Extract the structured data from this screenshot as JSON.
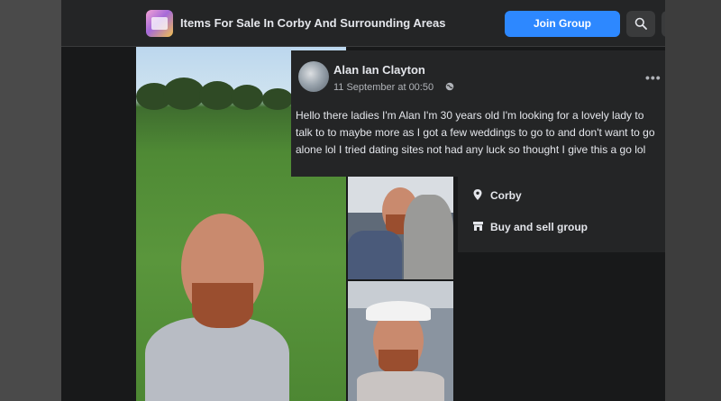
{
  "header": {
    "group_name": "Items For Sale In Corby And Surrounding Areas",
    "join_label": "Join Group"
  },
  "post": {
    "author": "Alan Ian Clayton",
    "timestamp": "11 September at 00:50",
    "body": "Hello there ladies I'm Alan I'm 30 years old  I'm looking for a lovely lady to talk to to maybe more as I got a few weddings to go to and don't want to go alone lol I tried dating sites not had any luck so thought I give this a go lol"
  },
  "info": {
    "location": "Corby",
    "category": "Buy and sell group"
  },
  "icons": {
    "search": "search-icon",
    "globe": "globe-icon",
    "more": "more-options-icon",
    "location": "location-pin-icon",
    "group": "storefront-icon"
  },
  "colors": {
    "accent": "#2d88ff",
    "surface": "#242526",
    "background": "#18191a",
    "text": "#e4e6eb",
    "muted": "#b0b3b8"
  }
}
